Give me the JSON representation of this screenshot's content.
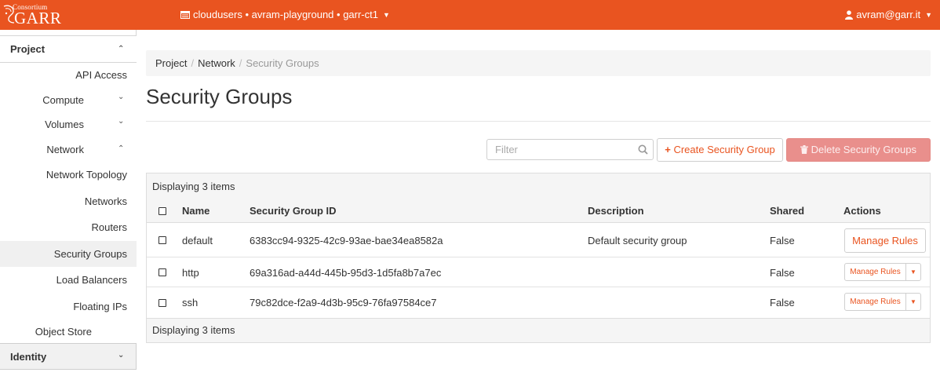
{
  "navbar": {
    "logo_line1": "Consortium",
    "logo_line2": "GARR",
    "context": "cloudusers • avram-playground • garr-ct1",
    "user": "avram@garr.it",
    "color": "#e95420"
  },
  "sidebar": {
    "project": "Project",
    "api_access": "API Access",
    "compute": "Compute",
    "volumes": "Volumes",
    "network": "Network",
    "network_items": [
      "Network Topology",
      "Networks",
      "Routers",
      "Security Groups",
      "Load Balancers",
      "Floating IPs"
    ],
    "active_item": "Security Groups",
    "object_store": "Object Store",
    "identity": "Identity"
  },
  "breadcrumb": [
    "Project",
    "Network",
    "Security Groups"
  ],
  "page_title": "Security Groups",
  "toolbar": {
    "filter_placeholder": "Filter",
    "create_label": "Create Security Group",
    "delete_label": "Delete Security Groups"
  },
  "table": {
    "caption": "Displaying 3 items",
    "columns": [
      "Name",
      "Security Group ID",
      "Description",
      "Shared",
      "Actions"
    ],
    "rows": [
      {
        "name": "default",
        "id": "6383cc94-9325-42c9-93ae-bae34ea8582a",
        "description": "Default security group",
        "shared": "False",
        "action": "Manage Rules"
      },
      {
        "name": "http",
        "id": "69a316ad-a44d-445b-95d3-1d5fa8b7a7ec",
        "description": "",
        "shared": "False",
        "action": "Manage Rules"
      },
      {
        "name": "ssh",
        "id": "79c82dce-f2a9-4d3b-95c9-76fa97584ce7",
        "description": "",
        "shared": "False",
        "action": "Manage Rules"
      }
    ],
    "footer": "Displaying 3 items"
  }
}
